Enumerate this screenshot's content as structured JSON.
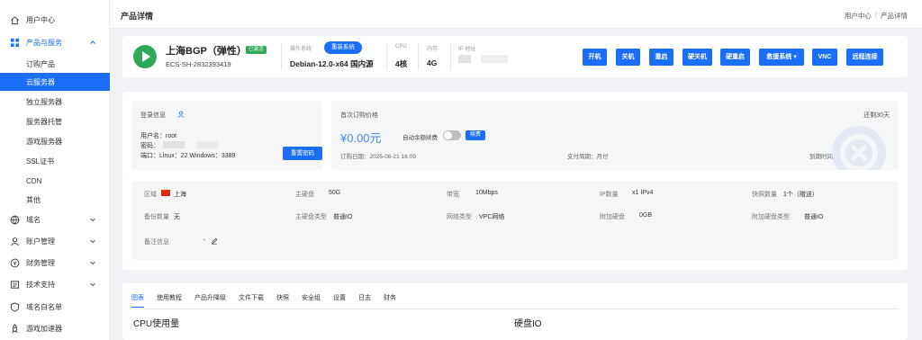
{
  "sidebar": {
    "items": [
      {
        "label": "用户中心",
        "icon": "home-icon"
      },
      {
        "label": "产品与服务",
        "icon": "grid-icon"
      },
      {
        "label": "域名",
        "icon": "globe-icon"
      },
      {
        "label": "账户管理",
        "icon": "user-icon"
      },
      {
        "label": "财务管理",
        "icon": "money-icon"
      },
      {
        "label": "技术支持",
        "icon": "ticket-icon"
      },
      {
        "label": "域名白名单",
        "icon": "shield-icon"
      },
      {
        "label": "游戏加速器",
        "icon": "rocket-icon"
      }
    ],
    "sub_items": [
      "订购产品",
      "云服务器",
      "独立服务器",
      "服务器托管",
      "游戏服务器",
      "SSL证书",
      "CDN",
      "其他"
    ],
    "active_sub": "云服务器"
  },
  "topbar": {
    "title": "产品详情",
    "breadcrumb": [
      "用户中心",
      "产品详情"
    ],
    "breadcrumb_sep": "/"
  },
  "product": {
    "name": "上海BGP（弹性）",
    "status_badge": "已激活",
    "id": "ECS-SH-2832393419",
    "os_label": "操作系统",
    "os_value": "Debian-12.0-x64 国内源",
    "reinstall_label": "重装系统",
    "cpu_label": "CPU",
    "cpu_value": "4核",
    "mem_label": "内存",
    "mem_value": "4G",
    "ip_label": "IP 地址",
    "actions": [
      "开机",
      "关机",
      "重启",
      "硬关机",
      "硬重启",
      "救援系统 ▾",
      "VNC",
      "远程连接"
    ]
  },
  "login": {
    "title": "登录信息",
    "username_label": "用户名：",
    "username": "root",
    "password_label": "密码：",
    "port_label": "端口：",
    "port_value": "Linux：22 Windows：3389",
    "reset_label": "重置密码"
  },
  "billing": {
    "title": "首次订购价格",
    "expire_in": "还剩30天",
    "price": "¥0.00元",
    "auto_renew_label": "自动余额续费",
    "auto_renew_on": false,
    "renew_label": "续费",
    "order_date": "订购日期：2025-08-21 16:09",
    "billing_cycle": "支付周期：月付",
    "expire_date": "到期时间：2025-09-21 16:09"
  },
  "specs": {
    "region_label": "区域",
    "region_value": "上海",
    "disk_label": "主硬盘",
    "disk_value": "50G",
    "bandwidth_label": "带宽",
    "bandwidth_value": "10Mbps",
    "ip_count_label": "IP数量",
    "ip_count_value": "x1 IPv4",
    "snapshot_label": "快照数量",
    "snapshot_value": "1个（赠送）",
    "backup_label": "备份数量",
    "backup_value": "无",
    "disk_type_label": "主硬盘类型",
    "disk_type_value": "普通IO",
    "network_label": "网络类型",
    "network_value": "VPC网络",
    "extra_disk_label": "附加硬盘",
    "extra_disk_value": "0GB",
    "extra_disk_type_label": "附加硬盘类型",
    "extra_disk_type_value": "普通IO",
    "note_label": "备注信息",
    "note_value": "-"
  },
  "tabs": [
    "图表",
    "使用教程",
    "产品升降级",
    "文件下载",
    "快照",
    "安全组",
    "设置",
    "日志",
    "财务"
  ],
  "charts": {
    "cpu_title": "CPU使用量",
    "disk_title": "硬盘IO"
  },
  "colors": {
    "accent": "#1a6ef7",
    "running": "#2fa858",
    "price": "#4a8af4"
  }
}
